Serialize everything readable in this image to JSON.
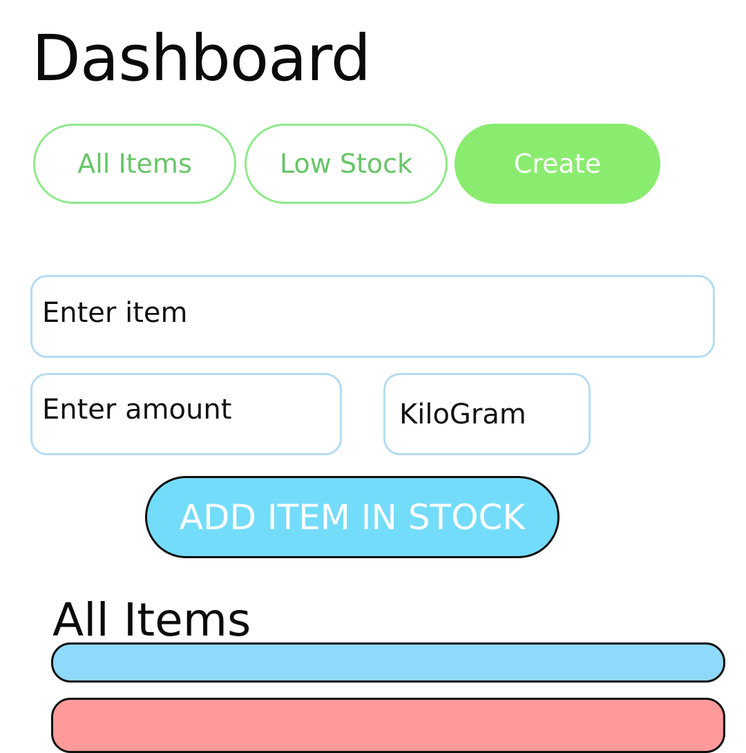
{
  "header": {
    "title": "Dashboard"
  },
  "tabs": [
    {
      "label": "All Items",
      "active": false
    },
    {
      "label": "Low Stock",
      "active": false
    },
    {
      "label": "Create",
      "active": true
    }
  ],
  "form": {
    "item_placeholder": "Enter item",
    "amount_placeholder": "Enter amount",
    "unit_value": "KiloGram",
    "submit_label": "ADD ITEM IN STOCK"
  },
  "list_section": {
    "title": "All Items",
    "cards": [
      {
        "status": "normal",
        "color": "#8fd9fb"
      },
      {
        "status": "low",
        "color": "#ff9a9a"
      }
    ]
  },
  "colors": {
    "accent_green": "#8aec6f",
    "tab_text_green": "#67c567",
    "input_border_blue": "#b6dcf2",
    "button_blue": "#74dcfb",
    "card_blue": "#8fd9fb",
    "card_red": "#ff9a9a"
  }
}
